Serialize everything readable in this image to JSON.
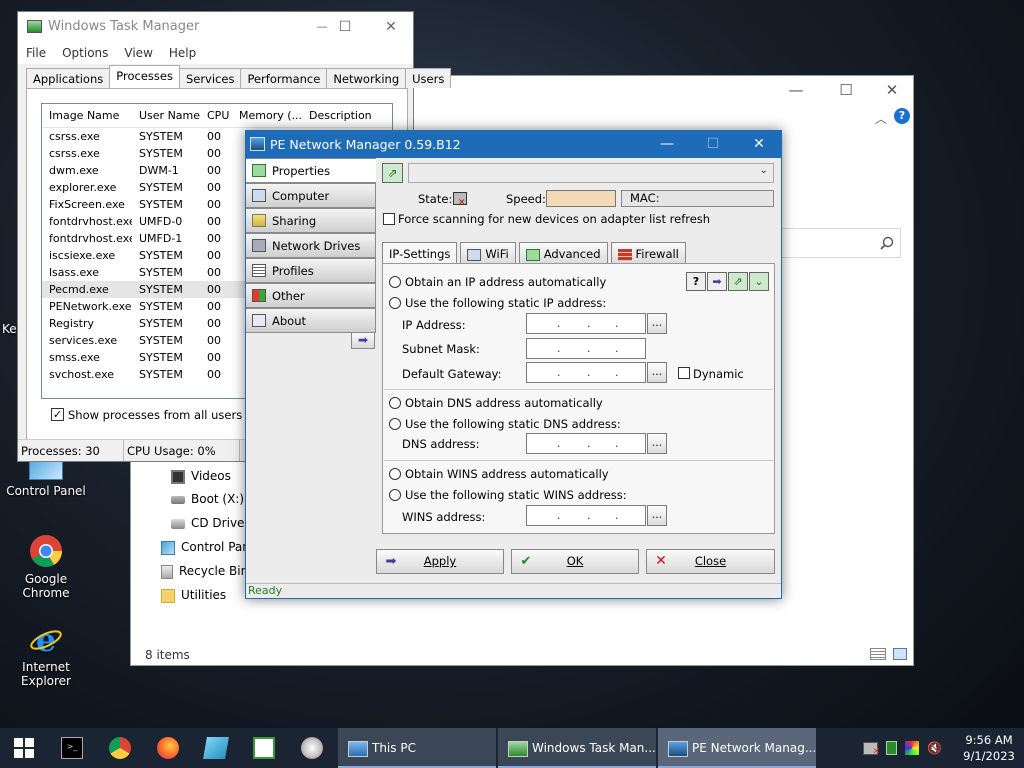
{
  "desktop": {
    "icons": [
      {
        "label": "Control Panel"
      },
      {
        "label": "Google Chrome"
      },
      {
        "label": "Internet Explorer"
      }
    ],
    "partial_label": "Key"
  },
  "explorer": {
    "status": "8 items",
    "nav": [
      {
        "label": "Videos"
      },
      {
        "label": "Boot (X:)"
      },
      {
        "label": "CD Drive ("
      },
      {
        "label": "Control Pan"
      },
      {
        "label": "Recycle Bin"
      },
      {
        "label": "Utilities"
      }
    ],
    "help_icon": "?",
    "min": "—",
    "max": "☐",
    "close": "✕"
  },
  "taskmgr": {
    "title": "Windows Task Manager",
    "menu": [
      "File",
      "Options",
      "View",
      "Help"
    ],
    "tabs": [
      "Applications",
      "Processes",
      "Services",
      "Performance",
      "Networking",
      "Users"
    ],
    "columns": [
      "Image Name",
      "User Name",
      "CPU",
      "Memory (...",
      "Description"
    ],
    "rows": [
      [
        "csrss.exe",
        "SYSTEM",
        "00"
      ],
      [
        "csrss.exe",
        "SYSTEM",
        "00"
      ],
      [
        "dwm.exe",
        "DWM-1",
        "00"
      ],
      [
        "explorer.exe",
        "SYSTEM",
        "00"
      ],
      [
        "FixScreen.exe",
        "SYSTEM",
        "00"
      ],
      [
        "fontdrvhost.exe",
        "UMFD-0",
        "00"
      ],
      [
        "fontdrvhost.exe",
        "UMFD-1",
        "00"
      ],
      [
        "iscsiexe.exe",
        "SYSTEM",
        "00"
      ],
      [
        "lsass.exe",
        "SYSTEM",
        "00"
      ],
      [
        "Pecmd.exe",
        "SYSTEM",
        "00"
      ],
      [
        "PENetwork.exe",
        "SYSTEM",
        "00"
      ],
      [
        "Registry",
        "SYSTEM",
        "00"
      ],
      [
        "services.exe",
        "SYSTEM",
        "00"
      ],
      [
        "smss.exe",
        "SYSTEM",
        "00"
      ],
      [
        "svchost.exe",
        "SYSTEM",
        "00"
      ]
    ],
    "show_all": "Show processes from all users",
    "processes": "Processes: 30",
    "cpu": "CPU Usage: 0%",
    "min": "—",
    "max": "☐",
    "close": "✕"
  },
  "penm": {
    "title": "PE Network Manager 0.59.B12",
    "min": "—",
    "max": "☐",
    "close": "✕",
    "side": [
      "Properties",
      "Computer",
      "Sharing",
      "Network Drives",
      "Profiles",
      "Other",
      "About"
    ],
    "state_label": "State:",
    "speed_label": "Speed:",
    "mac_label": "MAC:",
    "force_scan": "Force scanning for new devices on adapter list refresh",
    "tabs": [
      "IP-Settings",
      "WiFi",
      "Advanced",
      "Firewall"
    ],
    "ip_auto": "Obtain an IP address automatically",
    "ip_static": "Use the following static IP address:",
    "ip_address": "IP Address:",
    "subnet": "Subnet Mask:",
    "gateway": "Default Gateway:",
    "dynamic": "Dynamic",
    "dns_auto": "Obtain DNS address automatically",
    "dns_static": "Use the following static DNS address:",
    "dns_address": "DNS address:",
    "wins_auto": "Obtain WINS address automatically",
    "wins_static": "Use the following static WINS address:",
    "wins_address": "WINS address:",
    "browse": "...",
    "apply": "Apply",
    "ok": "OK",
    "close_btn": "Close",
    "status": "Ready"
  },
  "taskbar": {
    "apps": [
      {
        "label": "This PC"
      },
      {
        "label": "Windows Task Man..."
      },
      {
        "label": "PE Network Manag..."
      }
    ],
    "time": "9:56 AM",
    "date": "9/1/2023"
  }
}
